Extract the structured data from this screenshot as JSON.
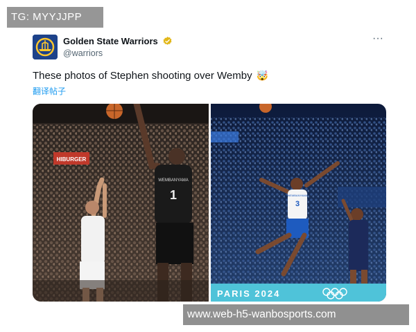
{
  "overlay": {
    "top_label": "TG: MYYJJPP",
    "bottom_label": "www.web-h5-wanbosports.com"
  },
  "tweet": {
    "author_name": "Golden State Warriors",
    "author_handle": "@warriors",
    "text": "These photos of Stephen shooting over Wemby",
    "emoji": "🤯",
    "translate_label": "翻译帖子",
    "more_label": "···"
  },
  "photos": {
    "left": {
      "jersey_number": "1",
      "jersey_name": "WEMBANYAMA",
      "sign_text": "HIBURGER"
    },
    "right": {
      "jersey_number": "3",
      "jersey_name": "WEMBANYAMA",
      "court_text": "PARIS 2024"
    }
  },
  "colors": {
    "accent": "#1d9bf0",
    "verified_badge": "#e2b719",
    "avatar_bg": "#1d428a",
    "avatar_logo": "#ffc72c"
  },
  "icons": {
    "avatar": "warriors-logo",
    "verified": "verified-badge-icon",
    "more": "more-options-icon"
  }
}
